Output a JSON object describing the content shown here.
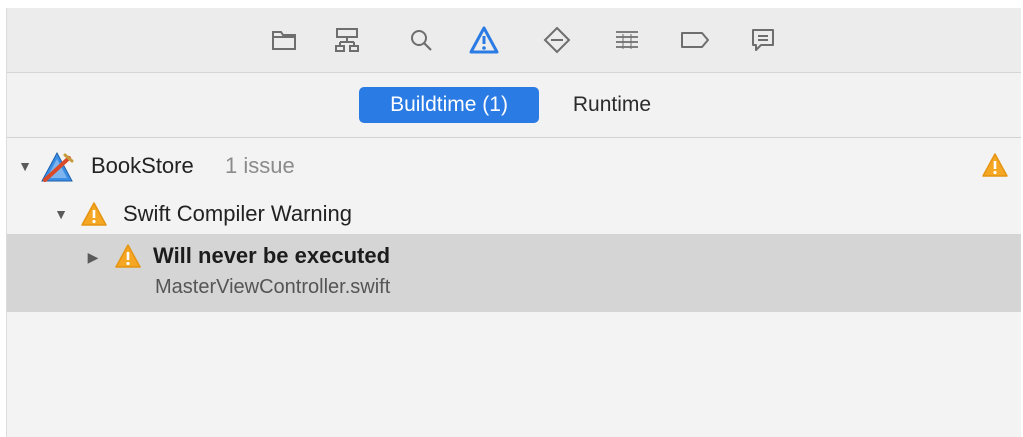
{
  "toolbar": {
    "icons": [
      {
        "name": "folder-icon"
      },
      {
        "name": "hierarchy-icon"
      },
      {
        "name": "search-icon"
      },
      {
        "name": "warning-icon",
        "active": true
      },
      {
        "name": "test-diamond-icon"
      },
      {
        "name": "debug-list-icon"
      },
      {
        "name": "breakpoint-tag-icon"
      },
      {
        "name": "report-message-icon"
      }
    ],
    "accent_color": "#2a7be4"
  },
  "scope": {
    "buildtime_label": "Buildtime (1)",
    "runtime_label": "Runtime"
  },
  "tree": {
    "project": {
      "name": "BookStore",
      "count": "1 issue"
    },
    "group": {
      "label": "Swift Compiler Warning"
    },
    "issue": {
      "title": "Will never be executed",
      "file": "MasterViewController.swift"
    }
  },
  "colors": {
    "warning": "#f5a623"
  }
}
